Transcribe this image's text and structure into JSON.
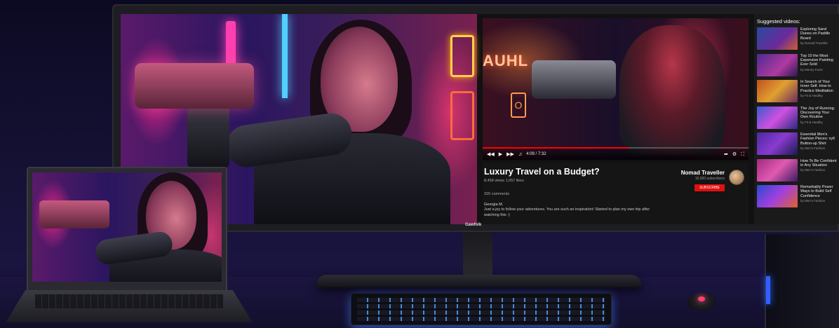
{
  "player": {
    "time": "4:09 / 7:32",
    "progress": 0.55,
    "play_icon": "play-icon",
    "sign_text": "O",
    "overlay_text": "AUHL"
  },
  "video": {
    "title": "Luxury Travel on a Budget?",
    "meta": "8,458 views  1,057 likes",
    "channel_name": "Nomad Traveller",
    "channel_subs": "10,000 subscribers",
    "subscribe_label": "SUBSCRIBE",
    "comments_count": "320 comments",
    "comment_author": "Georgia M.",
    "comment_text": "Just a joy to follow your adventures. You are such an inspiration! Started to plan my own trip after watching this :)"
  },
  "sidebar": {
    "title": "Suggested videos:",
    "items": [
      {
        "title": "Exploring Sand Dunes on Paddle Board",
        "channel": "by Nomad Traveller"
      },
      {
        "title": "Top 10 the Most Expensive Painting Ever Sold",
        "channel": "by Money Facts"
      },
      {
        "title": "In Search of Your Inner Self. How to Practice Meditation",
        "channel": "by Fit & Healthy"
      },
      {
        "title": "The Joy of Running: Discovering Your Own Routine",
        "channel": "by Fit & Healthy"
      },
      {
        "title": "Essential Men's Fashion Pieces: xy6 Button-up Shirt",
        "channel": "by Men's Fashion"
      },
      {
        "title": "How To Be Confident in Any Situation",
        "channel": "by Men's Fashion"
      },
      {
        "title": "Remarkably Power Ways to Build Self Confidence",
        "channel": "by Men's Fashion"
      }
    ]
  },
  "monitor": {
    "brand": "Gawfolk"
  }
}
